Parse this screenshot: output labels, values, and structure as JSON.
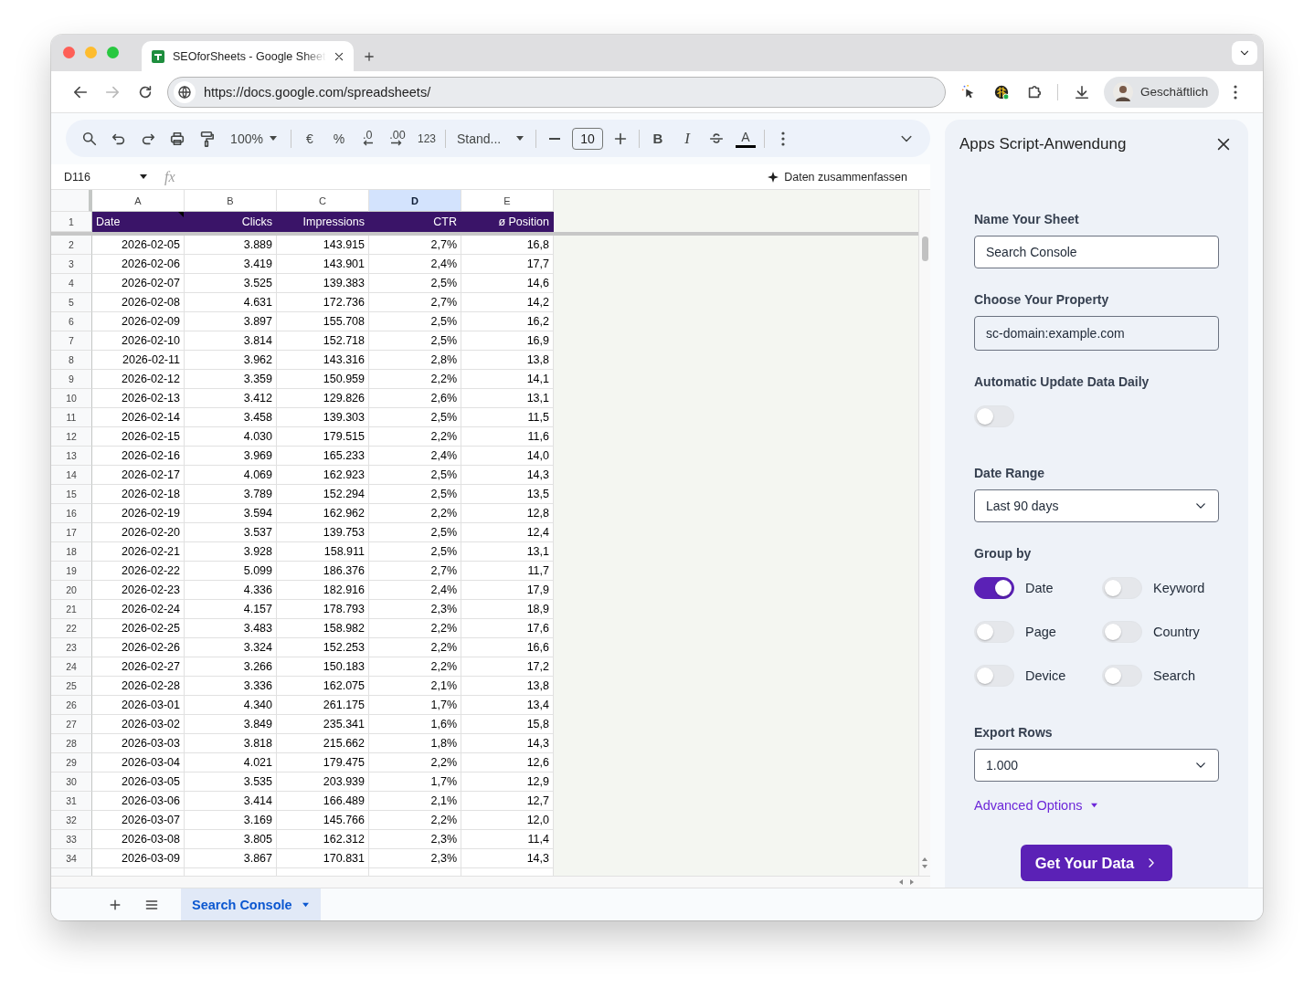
{
  "browser": {
    "tab": {
      "title": "SEOforSheets - Google Sheet",
      "selected": true
    },
    "url": "https://docs.google.com/spreadsheets/",
    "forward_disabled": true,
    "profile": "Geschäftlich"
  },
  "toolbar": {
    "zoom": "100%",
    "currency": "€",
    "percent": "%",
    "decrease_decimals": ".0",
    "increase_decimals": ".00",
    "number_format": "123",
    "font": "Stand...",
    "font_size": "10",
    "bold": "B",
    "italic": "I",
    "text_color": "A"
  },
  "formula_bar": {
    "cell_ref": "D116",
    "fx": "fx",
    "summarize": "Daten zusammenfassen"
  },
  "sheet": {
    "columns": [
      {
        "letter": "A",
        "selected": false
      },
      {
        "letter": "B",
        "selected": false
      },
      {
        "letter": "C",
        "selected": false
      },
      {
        "letter": "D",
        "selected": true
      },
      {
        "letter": "E",
        "selected": false
      }
    ],
    "header_row": {
      "number": "1",
      "cells": [
        "Date",
        "Clicks",
        "Impressions",
        "CTR",
        "ø Position"
      ]
    },
    "rows": [
      {
        "number": "2",
        "cells": [
          "2026-02-05",
          "3.889",
          "143.915",
          "2,7%",
          "16,8"
        ]
      },
      {
        "number": "3",
        "cells": [
          "2026-02-06",
          "3.419",
          "143.901",
          "2,4%",
          "17,7"
        ]
      },
      {
        "number": "4",
        "cells": [
          "2026-02-07",
          "3.525",
          "139.383",
          "2,5%",
          "14,6"
        ]
      },
      {
        "number": "5",
        "cells": [
          "2026-02-08",
          "4.631",
          "172.736",
          "2,7%",
          "14,2"
        ]
      },
      {
        "number": "6",
        "cells": [
          "2026-02-09",
          "3.897",
          "155.708",
          "2,5%",
          "16,2"
        ]
      },
      {
        "number": "7",
        "cells": [
          "2026-02-10",
          "3.814",
          "152.718",
          "2,5%",
          "16,9"
        ]
      },
      {
        "number": "8",
        "cells": [
          "2026-02-11",
          "3.962",
          "143.316",
          "2,8%",
          "13,8"
        ]
      },
      {
        "number": "9",
        "cells": [
          "2026-02-12",
          "3.359",
          "150.959",
          "2,2%",
          "14,1"
        ]
      },
      {
        "number": "10",
        "cells": [
          "2026-02-13",
          "3.412",
          "129.826",
          "2,6%",
          "13,1"
        ]
      },
      {
        "number": "11",
        "cells": [
          "2026-02-14",
          "3.458",
          "139.303",
          "2,5%",
          "11,5"
        ]
      },
      {
        "number": "12",
        "cells": [
          "2026-02-15",
          "4.030",
          "179.515",
          "2,2%",
          "11,6"
        ]
      },
      {
        "number": "13",
        "cells": [
          "2026-02-16",
          "3.969",
          "165.233",
          "2,4%",
          "14,0"
        ]
      },
      {
        "number": "14",
        "cells": [
          "2026-02-17",
          "4.069",
          "162.923",
          "2,5%",
          "14,3"
        ]
      },
      {
        "number": "15",
        "cells": [
          "2026-02-18",
          "3.789",
          "152.294",
          "2,5%",
          "13,5"
        ]
      },
      {
        "number": "16",
        "cells": [
          "2026-02-19",
          "3.594",
          "162.962",
          "2,2%",
          "12,8"
        ]
      },
      {
        "number": "17",
        "cells": [
          "2026-02-20",
          "3.537",
          "139.753",
          "2,5%",
          "12,4"
        ]
      },
      {
        "number": "18",
        "cells": [
          "2026-02-21",
          "3.928",
          "158.911",
          "2,5%",
          "13,1"
        ]
      },
      {
        "number": "19",
        "cells": [
          "2026-02-22",
          "5.099",
          "186.376",
          "2,7%",
          "11,7"
        ]
      },
      {
        "number": "20",
        "cells": [
          "2026-02-23",
          "4.336",
          "182.916",
          "2,4%",
          "17,9"
        ]
      },
      {
        "number": "21",
        "cells": [
          "2026-02-24",
          "4.157",
          "178.793",
          "2,3%",
          "18,9"
        ]
      },
      {
        "number": "22",
        "cells": [
          "2026-02-25",
          "3.483",
          "158.982",
          "2,2%",
          "17,6"
        ]
      },
      {
        "number": "23",
        "cells": [
          "2026-02-26",
          "3.324",
          "152.253",
          "2,2%",
          "16,6"
        ]
      },
      {
        "number": "24",
        "cells": [
          "2026-02-27",
          "3.266",
          "150.183",
          "2,2%",
          "17,2"
        ]
      },
      {
        "number": "25",
        "cells": [
          "2026-02-28",
          "3.336",
          "162.075",
          "2,1%",
          "13,8"
        ]
      },
      {
        "number": "26",
        "cells": [
          "2026-03-01",
          "4.340",
          "261.175",
          "1,7%",
          "13,4"
        ]
      },
      {
        "number": "27",
        "cells": [
          "2026-03-02",
          "3.849",
          "235.341",
          "1,6%",
          "15,8"
        ]
      },
      {
        "number": "28",
        "cells": [
          "2026-03-03",
          "3.818",
          "215.662",
          "1,8%",
          "14,3"
        ]
      },
      {
        "number": "29",
        "cells": [
          "2026-03-04",
          "4.021",
          "179.475",
          "2,2%",
          "12,6"
        ]
      },
      {
        "number": "30",
        "cells": [
          "2026-03-05",
          "3.535",
          "203.939",
          "1,7%",
          "12,9"
        ]
      },
      {
        "number": "31",
        "cells": [
          "2026-03-06",
          "3.414",
          "166.489",
          "2,1%",
          "12,7"
        ]
      },
      {
        "number": "32",
        "cells": [
          "2026-03-07",
          "3.169",
          "145.766",
          "2,2%",
          "12,0"
        ]
      },
      {
        "number": "33",
        "cells": [
          "2026-03-08",
          "3.805",
          "162.312",
          "2,3%",
          "11,4"
        ]
      },
      {
        "number": "34",
        "cells": [
          "2026-03-09",
          "3.867",
          "170.831",
          "2,3%",
          "14,3"
        ]
      }
    ]
  },
  "sheet_tabs": [
    {
      "label": "Search Console",
      "selected": true
    }
  ],
  "panel": {
    "title": "Apps Script-Anwendung",
    "fields": [
      {
        "kind": "text",
        "label": "Name Your Sheet",
        "value": "Search Console",
        "disabled": false
      },
      {
        "kind": "text",
        "label": "Choose Your Property",
        "value": "sc-domain:example.com",
        "disabled": true
      },
      {
        "kind": "toggle",
        "label": "Automatic Update Data Daily",
        "on": false
      },
      {
        "kind": "select",
        "label": "Date Range",
        "value": "Last 90 days"
      },
      {
        "kind": "toggles",
        "label": "Group by",
        "options": [
          {
            "label": "Date",
            "on": true
          },
          {
            "label": "Keyword",
            "on": false
          },
          {
            "label": "Page",
            "on": false
          },
          {
            "label": "Country",
            "on": false
          },
          {
            "label": "Device",
            "on": false
          },
          {
            "label": "Search",
            "on": false
          }
        ]
      },
      {
        "kind": "select",
        "label": "Export Rows",
        "value": "1.000"
      }
    ],
    "advanced_link": "Advanced Options",
    "submit": "Get Your Data"
  }
}
